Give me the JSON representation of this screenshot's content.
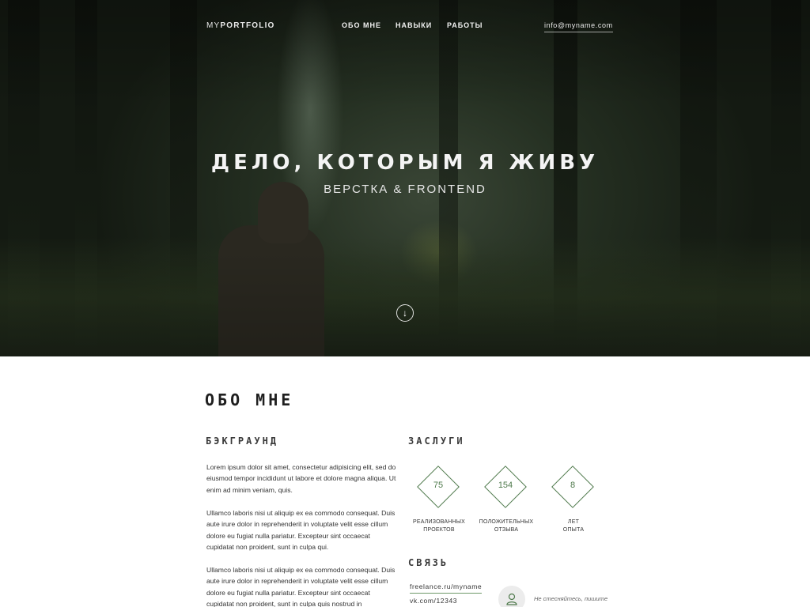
{
  "nav": {
    "logo_light": "MY",
    "logo_bold": "PORTFOLIO",
    "items": [
      {
        "label": "ОБО МНЕ"
      },
      {
        "label": "НАВЫКИ"
      },
      {
        "label": "РАБОТЫ"
      }
    ],
    "email": "info@myname.com"
  },
  "hero": {
    "title": "ДЕЛО, КОТОРЫМ Я ЖИВУ",
    "subtitle": "ВЕРСТКА & FRONTEND",
    "scroll_icon": "arrow-down-icon"
  },
  "about": {
    "title": "ОБО МНЕ",
    "background": {
      "heading": "БЭКГРАУНД",
      "paragraphs": [
        "Lorem ipsum dolor sit amet, consectetur adipisicing elit, sed do eiusmod tempor incididunt ut labore et dolore magna aliqua. Ut enim ad minim veniam, quis.",
        "Ullamco laboris nisi ut aliquip ex ea commodo consequat. Duis aute irure dolor in reprehenderit in voluptate velit esse cillum dolore eu fugiat nulla pariatur. Excepteur sint occaecat cupidatat non proident, sunt in culpa qui.",
        "Ullamco laboris nisi ut aliquip ex ea commodo consequat. Duis aute irure dolor in reprehenderit in voluptate velit esse cillum dolore eu fugiat nulla pariatur. Excepteur sint occaecat cupidatat non proident, sunt in culpa quis nostrud in"
      ]
    },
    "merits": {
      "heading": "ЗАСЛУГИ",
      "stats": [
        {
          "value": "75",
          "label_line1": "РЕАЛИЗОВАННЫХ",
          "label_line2": "ПРОЕКТОВ"
        },
        {
          "value": "154",
          "label_line1": "ПОЛОЖИТЕЛЬНЫХ",
          "label_line2": "ОТЗЫВА"
        },
        {
          "value": "8",
          "label_line1": "ЛЕТ",
          "label_line2": "ОПЫТА"
        }
      ]
    },
    "contact": {
      "heading": "СВЯЗЬ",
      "links": [
        "freelance.ru/myname",
        "vk.com/12343"
      ],
      "avatar_icon": "user-icon",
      "hint": "Не стесняйтесь, пишите"
    }
  },
  "colors": {
    "accent": "#4f7a4c",
    "hero_dark": "#1a2217"
  }
}
